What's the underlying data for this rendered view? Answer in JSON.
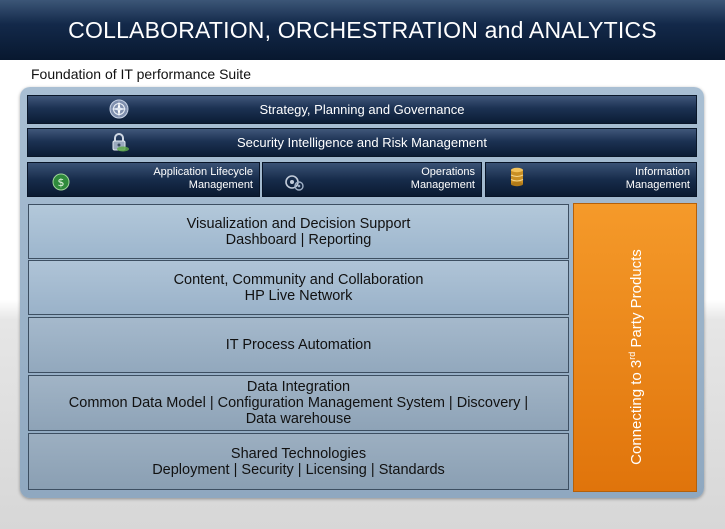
{
  "header": {
    "title": "COLLABORATION, ORCHESTRATION and ANALYTICS"
  },
  "subtitle": "Foundation of IT performance Suite",
  "top_bars": [
    {
      "label": "Strategy, Planning and Governance",
      "icon": "compass-icon"
    },
    {
      "label": "Security Intelligence and Risk Management",
      "icon": "lock-icon"
    }
  ],
  "management_tiles": [
    {
      "line1": "Application Lifecycle",
      "line2": "Management",
      "icon": "shield-dollar-icon"
    },
    {
      "line1": "Operations",
      "line2": "Management",
      "icon": "gears-icon"
    },
    {
      "line1": "Information",
      "line2": "Management",
      "icon": "database-icon"
    }
  ],
  "layers": [
    {
      "line1": "Visualization and Decision Support",
      "line2": "Dashboard | Reporting",
      "line3": ""
    },
    {
      "line1": "Content, Community and Collaboration",
      "line2": "HP Live Network",
      "line3": ""
    },
    {
      "line1": "IT Process Automation",
      "line2": "",
      "line3": ""
    },
    {
      "line1": "Data Integration",
      "line2": "Common Data Model | Configuration Management System | Discovery |",
      "line3": "Data warehouse"
    },
    {
      "line1": "Shared Technologies",
      "line2": "Deployment | Security | Licensing | Standards",
      "line3": ""
    }
  ],
  "side_panel": {
    "prefix": "Connecting to 3",
    "superscript": "rd",
    "suffix": " Party Products"
  },
  "colors": {
    "accent_orange": "#f08a1c",
    "navy": "#13294a",
    "layer_blue": "#a8c0d5"
  }
}
